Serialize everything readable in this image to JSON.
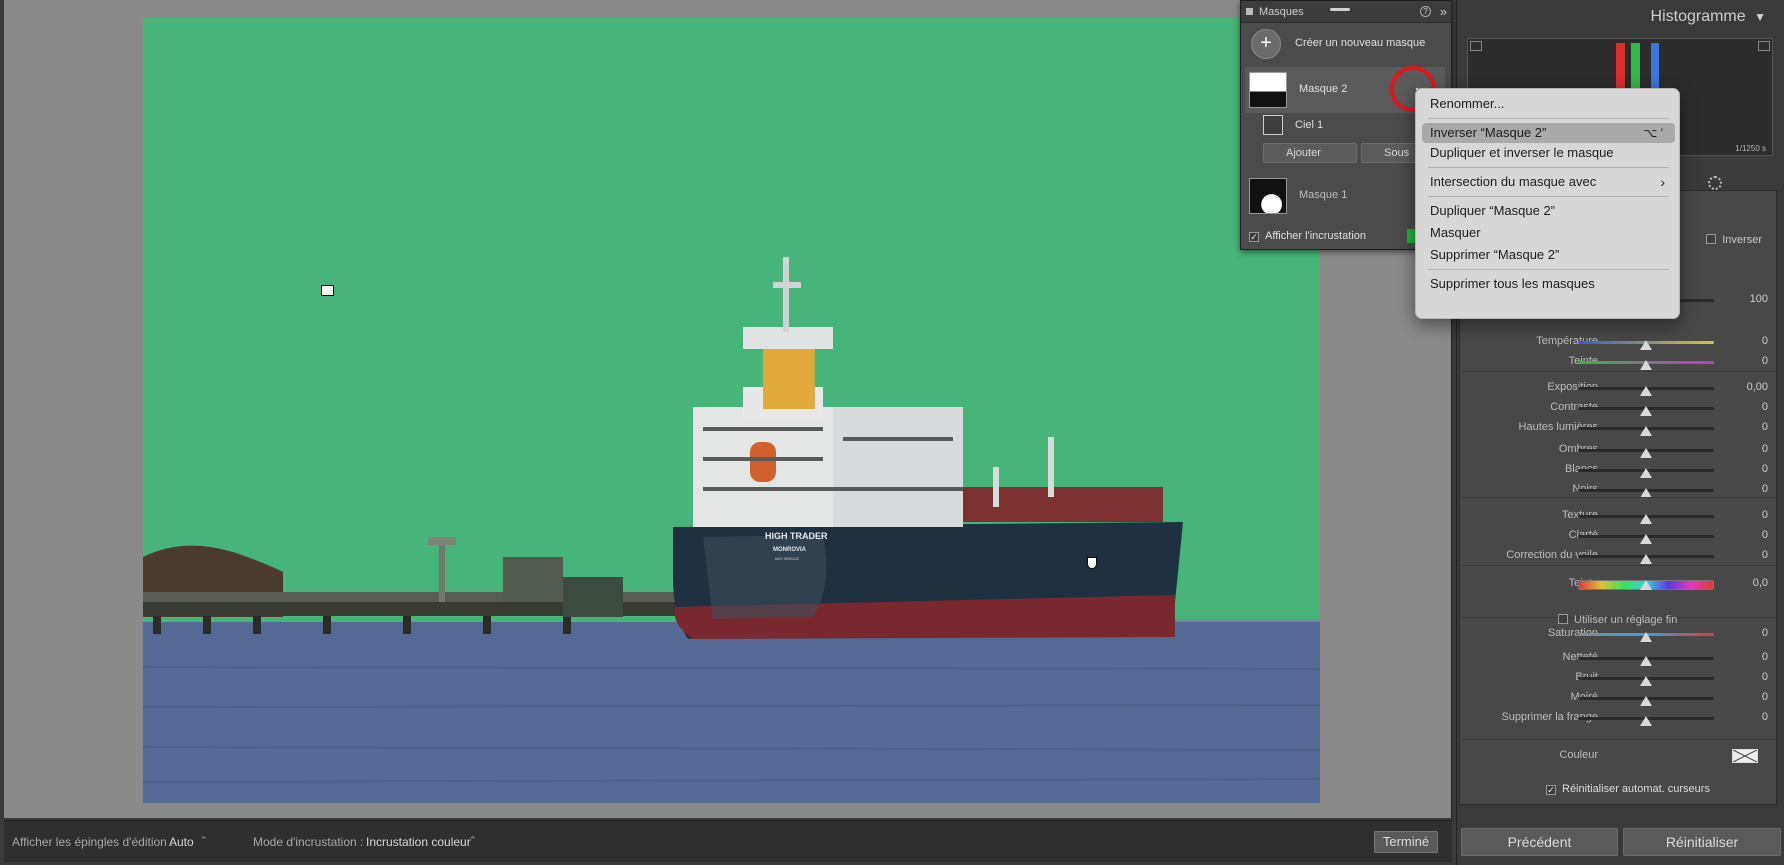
{
  "masks_panel": {
    "title": "Masques",
    "create_label": "Créer un nouveau masque",
    "mask2_label": "Masque 2",
    "sky_label": "Ciel 1",
    "add_label": "Ajouter",
    "subtract_label": "Sous",
    "mask1_label": "Masque 1",
    "overlay_label": "Afficher l'incrustation",
    "more_label": "..."
  },
  "photo": {
    "ship_name": "HIGH TRADER",
    "ship_port": "MONROVIA",
    "ship_imo": "IMO 9696242"
  },
  "context_menu": {
    "items": [
      {
        "label": "Renommer..."
      },
      {
        "label": "Inverser “Masque 2”",
        "shortcut": "⌥ '"
      },
      {
        "label": "Dupliquer et inverser le masque"
      },
      {
        "label": "Intersection du masque avec",
        "submenu": "›"
      },
      {
        "label": "Dupliquer “Masque 2”"
      },
      {
        "label": "Masquer"
      },
      {
        "label": "Supprimer “Masque 2”"
      },
      {
        "label": "Supprimer tous les masques"
      }
    ]
  },
  "right_panel": {
    "histogram_title": "Histogramme",
    "histogram_arrow": "▼",
    "shutter_readout": "1/1250 s",
    "invert_label": "Inverser",
    "amount_value": "100",
    "adjustments": [
      {
        "label": "Température",
        "value": "0",
        "track": "temp"
      },
      {
        "label": "Teinte",
        "value": "0",
        "track": "tint"
      },
      {
        "label": "Exposition",
        "value": "0,00",
        "track": "plain"
      },
      {
        "label": "Contraste",
        "value": "0",
        "track": "plain"
      },
      {
        "label": "Hautes lumières",
        "value": "0",
        "track": "plain"
      },
      {
        "label": "Ombres",
        "value": "0",
        "track": "plain"
      },
      {
        "label": "Blancs",
        "value": "0",
        "track": "plain"
      },
      {
        "label": "Noirs",
        "value": "0",
        "track": "plain"
      },
      {
        "label": "Texture",
        "value": "0",
        "track": "plain"
      },
      {
        "label": "Clarté",
        "value": "0",
        "track": "plain"
      },
      {
        "label": "Correction du voile",
        "value": "0",
        "track": "plain"
      },
      {
        "label": "Teinte",
        "value": "0,0",
        "track": "hue"
      },
      {
        "label": "Saturation",
        "value": "0",
        "track": "sat"
      },
      {
        "label": "Netteté",
        "value": "0",
        "track": "plain"
      },
      {
        "label": "Bruit",
        "value": "0",
        "track": "plain"
      },
      {
        "label": "Moiré",
        "value": "0",
        "track": "plain"
      },
      {
        "label": "Supprimer la frange",
        "value": "0",
        "track": "plain"
      }
    ],
    "fine_tune_label": "Utiliser un réglage fin",
    "color_label": "Couleur",
    "reset_sliders_label": "Réinitialiser automat. curseurs",
    "prev_button": "Précédent",
    "reset_button": "Réinitialiser"
  },
  "bottom_bar": {
    "pins_label": "Afficher les épingles d'édition :",
    "pins_value": "Auto",
    "overlay_mode_label": "Mode d'incrustation :",
    "overlay_mode_value": "Incrustation couleur",
    "done_button": "Terminé",
    "dropdown_glyph": "⌃"
  },
  "colors": {
    "mask_overlay": "#47b479",
    "highlight_circle": "#e0161d",
    "menu_bg": "#d7d7d7"
  }
}
